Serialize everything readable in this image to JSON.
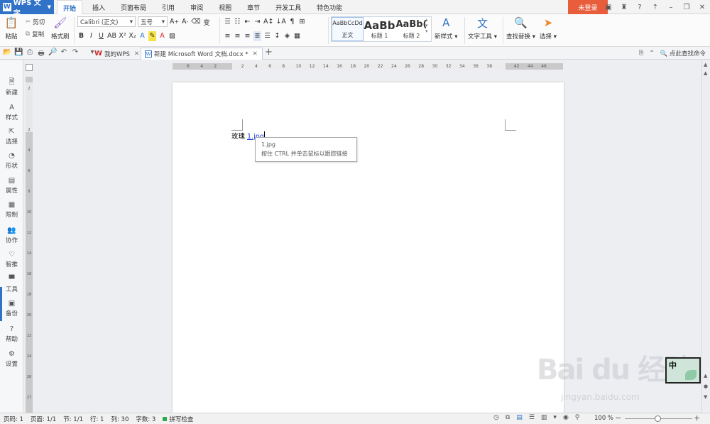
{
  "app": {
    "name": "WPS 文字",
    "logo_glyph": "W"
  },
  "menu": {
    "tabs": [
      "开始",
      "插入",
      "页面布局",
      "引用",
      "审阅",
      "视图",
      "章节",
      "开发工具",
      "特色功能"
    ],
    "active": "开始"
  },
  "account": {
    "login_label": "未登录",
    "login_color": "#e85d3c"
  },
  "ribbon": {
    "paste_label": "粘贴",
    "cut_label": "剪切",
    "copy_label": "复制",
    "format_painter_label": "格式刷",
    "font_name": "Calibri (正文)",
    "font_size": "五号",
    "styles": [
      {
        "sample": "AaBbCcDd",
        "name": "正文"
      },
      {
        "sample": "AaBb",
        "name": "标题 1"
      },
      {
        "sample": "AaBb(",
        "name": "标题 2"
      }
    ],
    "new_style_label": "新样式",
    "text_tools_label": "文字工具",
    "find_replace_label": "查找替换",
    "select_label": "选择"
  },
  "tabs_bar": {
    "home_tab": "我的WPS",
    "doc_tab": "新建 Microsoft Word 文档.docx *",
    "search_label": "点此查找命令"
  },
  "sidebar": {
    "items": [
      {
        "label": "新建",
        "icon": "new-doc-icon"
      },
      {
        "label": "样式",
        "icon": "style-icon"
      },
      {
        "label": "选择",
        "icon": "select-icon"
      },
      {
        "label": "形状",
        "icon": "shape-icon"
      },
      {
        "label": "属性",
        "icon": "properties-icon"
      },
      {
        "label": "限制",
        "icon": "restrict-icon"
      },
      {
        "label": "协作",
        "icon": "collaborate-icon"
      },
      {
        "label": "智推",
        "icon": "recommend-icon"
      },
      {
        "label": "工具",
        "icon": "tools-icon"
      },
      {
        "label": "备份",
        "icon": "backup-icon"
      },
      {
        "label": "帮助",
        "icon": "help-icon"
      },
      {
        "label": "设置",
        "icon": "settings-icon"
      }
    ]
  },
  "ruler": {
    "h_ticks": [
      "6",
      "4",
      "2",
      "",
      "2",
      "4",
      "6",
      "8",
      "10",
      "12",
      "14",
      "16",
      "18",
      "20",
      "22",
      "24",
      "26",
      "28",
      "30",
      "32",
      "34",
      "36",
      "38",
      "",
      "42",
      "44",
      "46"
    ],
    "v_ticks": [
      "2",
      "",
      "2",
      "4",
      "6",
      "8",
      "10",
      "12",
      "14",
      "16",
      "18",
      "20",
      "22",
      "24",
      "26",
      "27"
    ]
  },
  "document": {
    "text": "玫瑰",
    "link_text": "1.jpg",
    "tooltip_title": "1.jpg",
    "tooltip_hint": "按住 CTRL 并单击鼠标以跟踪链接"
  },
  "ime": {
    "label": "中"
  },
  "watermark": {
    "brand": "Bai du 经验",
    "url": "jingyan.baidu.com"
  },
  "status": {
    "page": "页码: 1",
    "pages": "页面: 1/1",
    "section": "节: 1/1",
    "row": "行: 1",
    "col": "列: 30",
    "words": "字数: 3",
    "spell": "拼写检查",
    "zoom": "100 %"
  },
  "colors": {
    "accent": "#2f72c7",
    "link": "#1a3ed9"
  }
}
